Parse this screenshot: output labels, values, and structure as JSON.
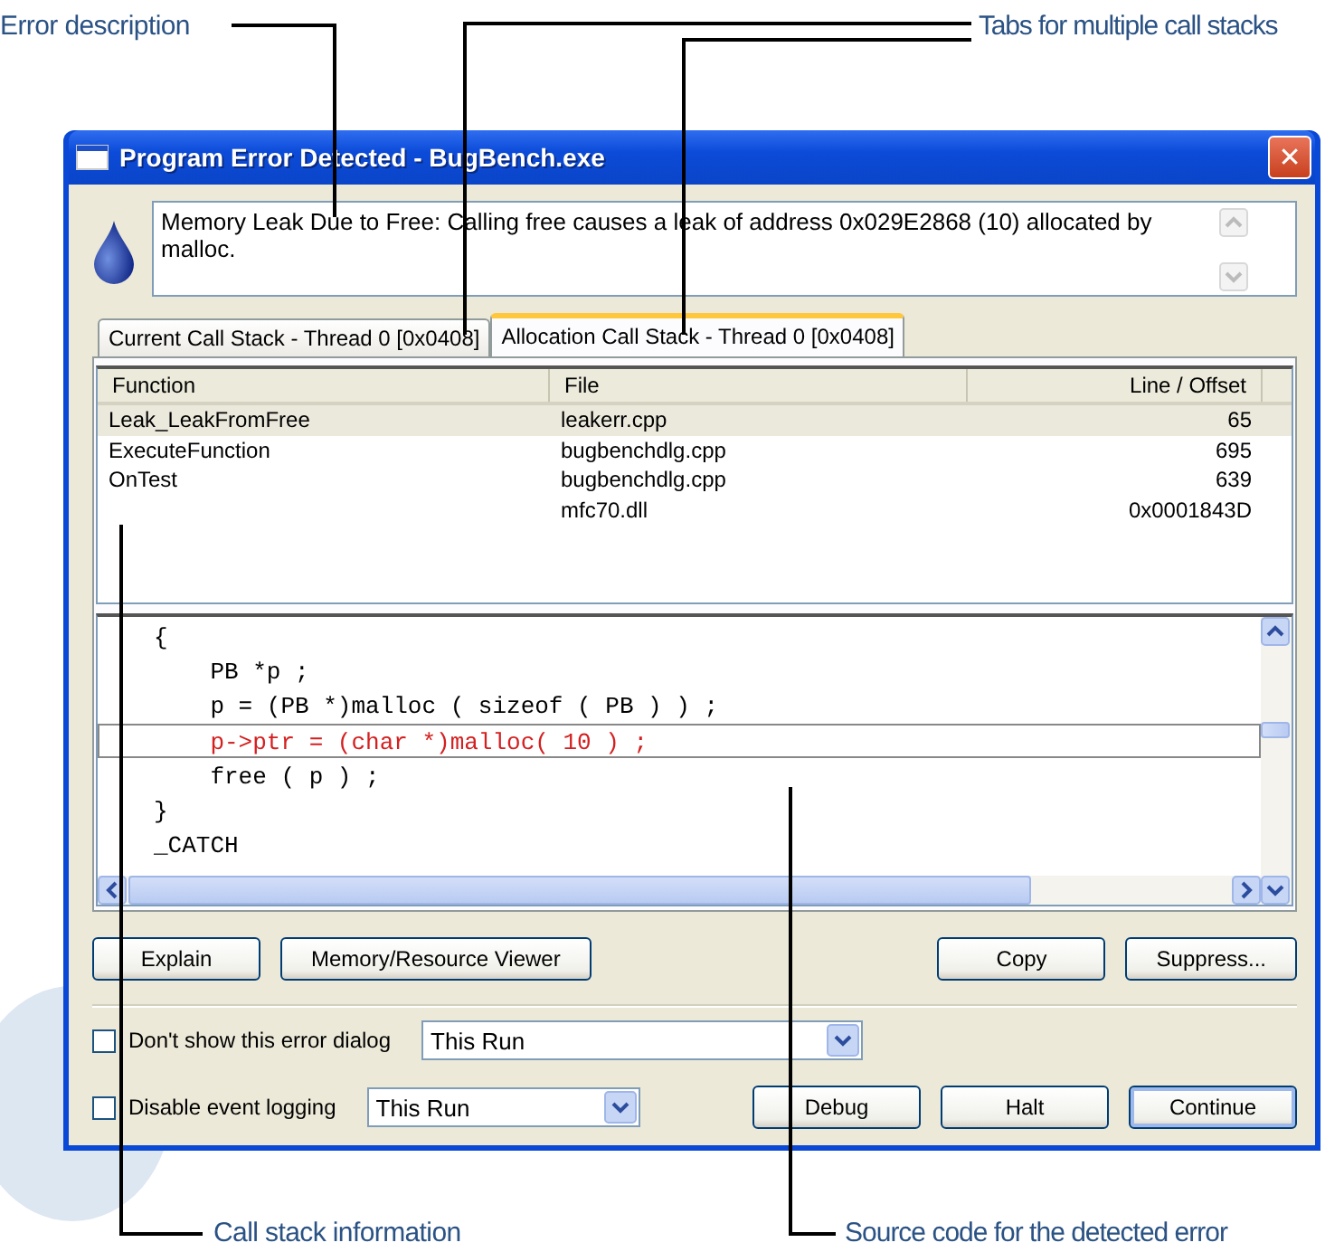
{
  "annotations": [
    {
      "text": "Error description"
    },
    {
      "text": "Tabs for multiple call stacks"
    },
    {
      "text": "Call stack information"
    },
    {
      "text": "Source code for the detected error"
    }
  ],
  "window": {
    "title": "Program Error Detected - BugBench.exe",
    "close_symbol": "✕"
  },
  "description": {
    "text": "Memory Leak Due to Free: Calling free causes a leak of address 0x029E2868 (10) allocated by malloc."
  },
  "tabs": [
    {
      "label": "Current Call Stack - Thread 0 [0x0408]",
      "selected": false
    },
    {
      "label": "Allocation Call Stack - Thread 0 [0x0408]",
      "selected": true
    }
  ],
  "call_stack": {
    "columns": [
      "Function",
      "File",
      "Line / Offset"
    ],
    "rows": [
      {
        "function": "Leak_LeakFromFree",
        "file": "leakerr.cpp",
        "line": "65",
        "selected": true
      },
      {
        "function": "ExecuteFunction",
        "file": "bugbenchdlg.cpp",
        "line": "695",
        "selected": false
      },
      {
        "function": "OnTest",
        "file": "bugbenchdlg.cpp",
        "line": "639",
        "selected": false
      },
      {
        "function": "",
        "file": "mfc70.dll",
        "line": "0x0001843D",
        "selected": false
      }
    ]
  },
  "source": {
    "lines": [
      {
        "text": "{",
        "highlighted": false
      },
      {
        "text": "    PB *p ;",
        "highlighted": false
      },
      {
        "text": "    p = (PB *)malloc ( sizeof ( PB ) ) ;",
        "highlighted": false
      },
      {
        "text": "    p->ptr = (char *)malloc( 10 ) ;",
        "highlighted": true
      },
      {
        "text": "    free ( p ) ;",
        "highlighted": false
      },
      {
        "text": "}",
        "highlighted": false
      },
      {
        "text": "_CATCH",
        "highlighted": false
      }
    ]
  },
  "action_buttons_left": [
    "Explain",
    "Memory/Resource Viewer"
  ],
  "action_buttons_right": [
    "Copy",
    "Suppress..."
  ],
  "options": [
    {
      "label": "Don't show this error dialog",
      "checked": false,
      "dropdown": "This Run"
    },
    {
      "label": "Disable event logging",
      "checked": false,
      "dropdown": "This Run"
    }
  ],
  "dialog_buttons": [
    {
      "label": "Debug",
      "default": false
    },
    {
      "label": "Halt",
      "default": false
    },
    {
      "label": "Continue",
      "default": true
    }
  ]
}
